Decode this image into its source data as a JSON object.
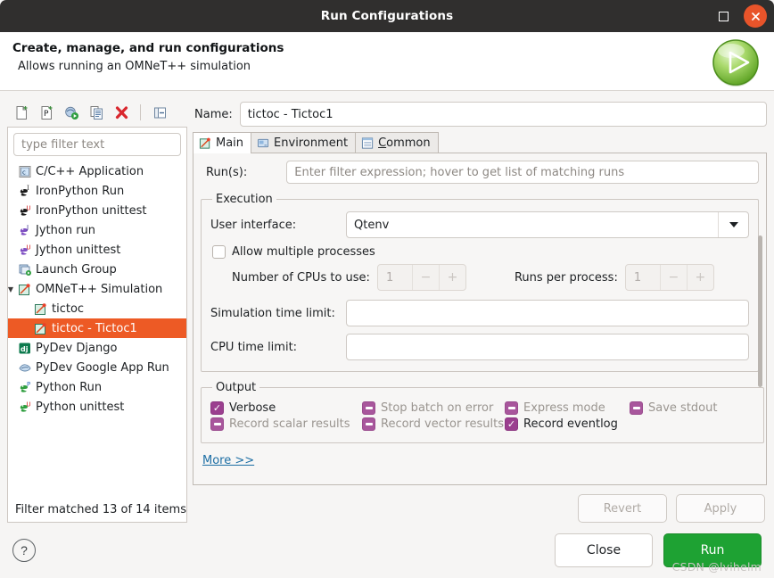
{
  "window": {
    "title": "Run Configurations",
    "maximize_label": "Maximize",
    "close_label": "×"
  },
  "header": {
    "title": "Create, manage, and run configurations",
    "subtitle": "Allows running an OMNeT++ simulation",
    "icon": "run-play-icon"
  },
  "left_toolbar": {
    "items": [
      {
        "name": "new-configuration-icon",
        "tooltip": "New launch configuration"
      },
      {
        "name": "new-prototype-icon",
        "tooltip": "New prototype"
      },
      {
        "name": "export-icon",
        "tooltip": "Export"
      },
      {
        "name": "duplicate-icon",
        "tooltip": "Duplicate"
      },
      {
        "name": "delete-icon",
        "tooltip": "Delete"
      },
      {
        "name": "collapse-all-icon",
        "tooltip": "Collapse All"
      }
    ]
  },
  "filter": {
    "placeholder": "type filter text",
    "value": "",
    "status": "Filter matched 13 of 14 items"
  },
  "tree": {
    "items": [
      {
        "label": "C/C++ Application",
        "icon": "cpp-app-icon",
        "depth": 0,
        "selected": false,
        "expander": ""
      },
      {
        "label": "IronPython Run",
        "icon": "ironpython-run-icon",
        "depth": 0,
        "selected": false,
        "expander": ""
      },
      {
        "label": "IronPython unittest",
        "icon": "ironpython-unittest-icon",
        "depth": 0,
        "selected": false,
        "expander": ""
      },
      {
        "label": "Jython run",
        "icon": "jython-run-icon",
        "depth": 0,
        "selected": false,
        "expander": ""
      },
      {
        "label": "Jython unittest",
        "icon": "jython-unittest-icon",
        "depth": 0,
        "selected": false,
        "expander": ""
      },
      {
        "label": "Launch Group",
        "icon": "launch-group-icon",
        "depth": 0,
        "selected": false,
        "expander": ""
      },
      {
        "label": "OMNeT++ Simulation",
        "icon": "omnetpp-simulation-icon",
        "depth": 0,
        "selected": false,
        "expander": "▼"
      },
      {
        "label": "tictoc",
        "icon": "omnetpp-config-icon",
        "depth": 1,
        "selected": false,
        "expander": ""
      },
      {
        "label": "tictoc - Tictoc1",
        "icon": "omnetpp-config-icon",
        "depth": 1,
        "selected": true,
        "expander": ""
      },
      {
        "label": "PyDev Django",
        "icon": "pydev-django-icon",
        "depth": 0,
        "selected": false,
        "expander": ""
      },
      {
        "label": "PyDev Google App Run",
        "icon": "pydev-google-app-icon",
        "depth": 0,
        "selected": false,
        "expander": ""
      },
      {
        "label": "Python Run",
        "icon": "python-run-icon",
        "depth": 0,
        "selected": false,
        "expander": ""
      },
      {
        "label": "Python unittest",
        "icon": "python-unittest-icon",
        "depth": 0,
        "selected": false,
        "expander": ""
      }
    ]
  },
  "config": {
    "name_label": "Name:",
    "name_value": "tictoc - Tictoc1",
    "tabs": [
      {
        "label": "Main",
        "icon": "omnetpp-config-icon",
        "active": true,
        "mnemonic": ""
      },
      {
        "label": "Environment",
        "icon": "environment-icon",
        "active": false,
        "mnemonic": ""
      },
      {
        "label": "Common",
        "icon": "common-icon",
        "active": false,
        "mnemonic": "C"
      }
    ],
    "runs": {
      "label": "Run(s):",
      "placeholder": "Enter filter expression; hover to get list of matching runs",
      "value": ""
    },
    "execution": {
      "legend": "Execution",
      "user_interface_label": "User interface:",
      "user_interface_value": "Qtenv",
      "allow_multiple_label": "Allow multiple processes",
      "allow_multiple_checked": false,
      "cpus_label": "Number of CPUs to use:",
      "cpus_value": "1",
      "runs_per_process_label": "Runs per process:",
      "runs_per_process_value": "1",
      "sim_time_label": "Simulation time limit:",
      "sim_time_value": "",
      "cpu_time_label": "CPU time limit:",
      "cpu_time_value": ""
    },
    "output": {
      "legend": "Output",
      "row1": [
        {
          "label": "Verbose",
          "state": "checked"
        },
        {
          "label": "Stop batch on error",
          "state": "indeterminate"
        },
        {
          "label": "Express mode",
          "state": "indeterminate"
        },
        {
          "label": "Save stdout",
          "state": "indeterminate"
        }
      ],
      "row2": [
        {
          "label": "Record scalar results",
          "state": "indeterminate"
        },
        {
          "label": "Record vector results",
          "state": "indeterminate"
        },
        {
          "label": "Record eventlog",
          "state": "checked"
        }
      ],
      "more_label": "More >>"
    },
    "revert_label": "Revert",
    "apply_label": "Apply"
  },
  "footer": {
    "help_label": "?",
    "close_label": "Close",
    "run_label": "Run",
    "watermark": "CSDN @lvihelm"
  },
  "colors": {
    "titlebar_bg": "#302f2e",
    "close_btn": "#e8542a",
    "selection": "#ed5a25",
    "run_button": "#1ea233",
    "checkbox_checked": "#9b3f8f",
    "checkbox_indeterminate": "#a8569c",
    "link": "#1c6ea4"
  }
}
